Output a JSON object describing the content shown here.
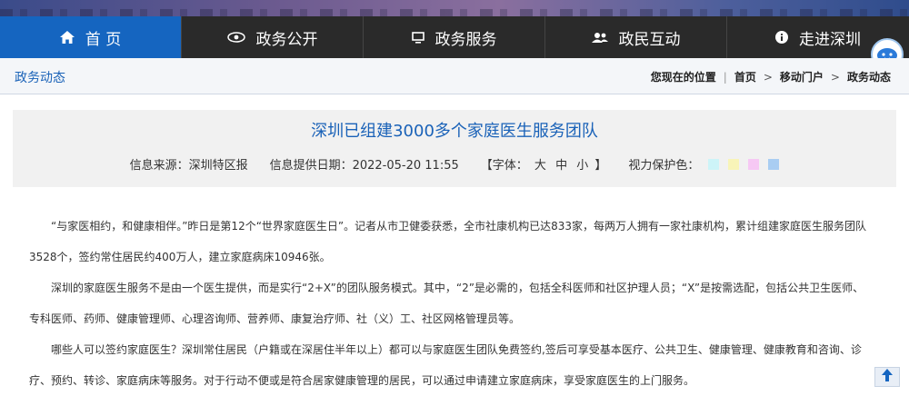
{
  "nav": {
    "items": [
      {
        "label": "首 页",
        "icon": "home-icon"
      },
      {
        "label": "政务公开",
        "icon": "eye-icon"
      },
      {
        "label": "政务服务",
        "icon": "monitor-icon"
      },
      {
        "label": "政民互动",
        "icon": "people-icon"
      },
      {
        "label": "走进深圳",
        "icon": "info-icon"
      }
    ],
    "active_color": "#1565c0"
  },
  "subbar": {
    "section_title": "政务动态",
    "breadcrumb": {
      "prefix": "您现在的位置",
      "items": [
        "首页",
        "移动门户",
        "政务动态"
      ],
      "separator": ">"
    }
  },
  "article": {
    "title": "深圳已组建3000多个家庭医生服务团队",
    "source": "信息来源：深圳特区报",
    "date": "信息提供日期：2022-05-20 11:55",
    "font_label_open": "【字体：",
    "font_sizes": [
      "大",
      "中",
      "小"
    ],
    "font_label_close": "】",
    "vision_label": "视力保护色：",
    "vision_colors": [
      "#cdf4f8",
      "#f8f4b8",
      "#f6c8f4",
      "#a9cdf2"
    ],
    "paragraphs": [
      "“与家医相约，和健康相伴。”昨日是第12个“世界家庭医生日”。记者从市卫健委获悉，全市社康机构已达833家，每两万人拥有一家社康机构，累计组建家庭医生服务团队3528个，签约常住居民约400万人，建立家庭病床10946张。",
      "深圳的家庭医生服务不是由一个医生提供，而是实行“2+X”的团队服务模式。其中，“2”是必需的，包括全科医师和社区护理人员；“X”是按需选配，包括公共卫生医师、专科医师、药师、健康管理师、心理咨询师、营养师、康复治疗师、社（义）工、社区网格管理员等。",
      "哪些人可以签约家庭医生？深圳常住居民（户籍或在深居住半年以上）都可以与家庭医生团队免费签约,签后可享受基本医疗、公共卫生、健康管理、健康教育和咨询、诊疗、预约、转诊、家庭病床等服务。对于行动不便或是符合居家健康管理的居民，可以通过申请建立家庭病床，享受家庭医生的上门服务。"
    ]
  }
}
